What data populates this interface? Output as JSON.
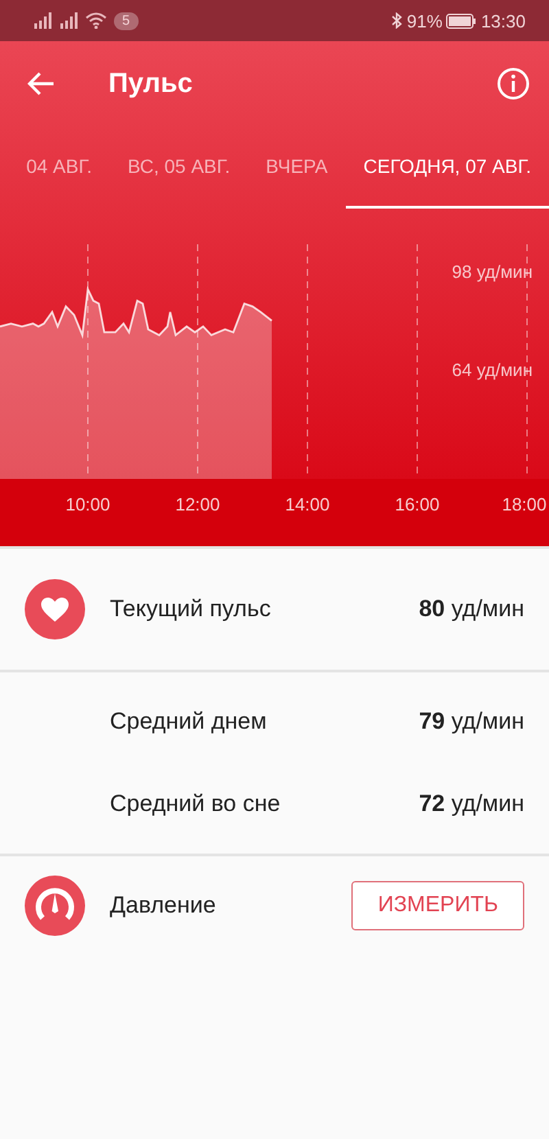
{
  "status_bar": {
    "notification_count": "5",
    "battery": "91%",
    "time": "13:30"
  },
  "app_bar": {
    "title": "Пульс"
  },
  "tabs": [
    {
      "label": "04 АВГ.",
      "selected": false
    },
    {
      "label": "ВС, 05 АВГ.",
      "selected": false
    },
    {
      "label": "ВЧЕРА",
      "selected": false
    },
    {
      "label": "СЕГОДНЯ, 07 АВГ.",
      "selected": true
    }
  ],
  "graph": {
    "y_labels": [
      "98 уд/мин",
      "64 уд/мин"
    ],
    "x_labels": [
      "10:00",
      "12:00",
      "14:00",
      "16:00",
      "18:00"
    ]
  },
  "sections": [
    {
      "kind": "current",
      "rows": [
        {
          "label": "Текущий пульс",
          "value": "80",
          "unit": " уд/мин"
        }
      ]
    },
    {
      "kind": "average",
      "rows": [
        {
          "label": "Средний днем",
          "value": "79",
          "unit": " уд/мин"
        },
        {
          "label": "Средний во сне",
          "value": "72",
          "unit": " уд/мин"
        }
      ]
    },
    {
      "kind": "action",
      "rows": [
        {
          "label": "Давление",
          "button": "ИЗМЕРИТЬ"
        }
      ]
    }
  ]
}
